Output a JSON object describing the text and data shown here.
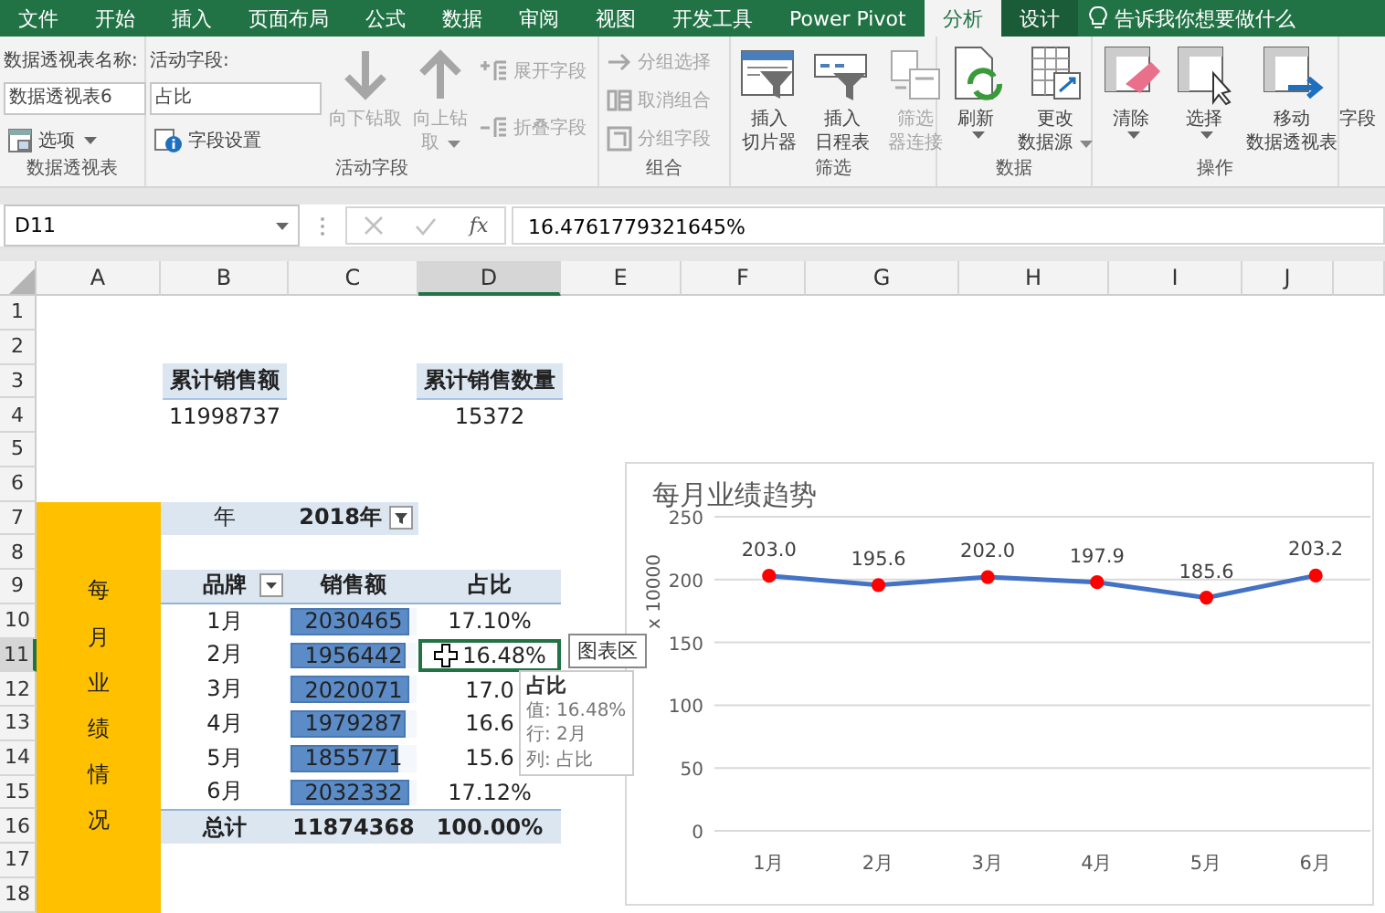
{
  "menu_tabs": [
    {
      "label": "文件",
      "selected": false,
      "contextual": false
    },
    {
      "label": "开始",
      "selected": false,
      "contextual": false
    },
    {
      "label": "插入",
      "selected": false,
      "contextual": false
    },
    {
      "label": "页面布局",
      "selected": false,
      "contextual": false
    },
    {
      "label": "公式",
      "selected": false,
      "contextual": false
    },
    {
      "label": "数据",
      "selected": false,
      "contextual": false
    },
    {
      "label": "审阅",
      "selected": false,
      "contextual": false
    },
    {
      "label": "视图",
      "selected": false,
      "contextual": false
    },
    {
      "label": "开发工具",
      "selected": false,
      "contextual": false
    },
    {
      "label": "Power Pivot",
      "selected": false,
      "contextual": false
    },
    {
      "label": "分析",
      "selected": true,
      "contextual": true
    },
    {
      "label": "设计",
      "selected": false,
      "contextual": true
    }
  ],
  "tell_me": "告诉我你想要做什么",
  "ribbon": [
    {
      "label": "数据透视表",
      "columns": [
        [
          {
            "kind": "caption",
            "label": "数据透视表名称:"
          },
          {
            "kind": "input",
            "value": "数据透视表6"
          },
          {
            "kind": "small",
            "label": "选项",
            "disabled": false,
            "dropdown": true
          }
        ]
      ]
    },
    {
      "label": "活动字段",
      "columns": [
        [
          {
            "kind": "caption",
            "label": "活动字段:"
          },
          {
            "kind": "input",
            "value": "占比"
          },
          {
            "kind": "small",
            "label": "字段设置",
            "disabled": false,
            "dropdown": false
          }
        ],
        [
          {
            "kind": "large",
            "lines": [
              "向下钻取"
            ],
            "disabled": true,
            "dropdown": false
          }
        ],
        [
          {
            "kind": "large",
            "lines": [
              "向上钻",
              "取"
            ],
            "disabled": true,
            "dropdown": true
          }
        ],
        [
          {
            "kind": "small",
            "label": "展开字段",
            "disabled": true,
            "dropdown": false
          },
          {
            "kind": "small",
            "label": "折叠字段",
            "disabled": true,
            "dropdown": false
          }
        ]
      ]
    },
    {
      "label": "组合",
      "columns": [
        [
          {
            "kind": "small",
            "label": "分组选择",
            "disabled": true,
            "dropdown": false
          },
          {
            "kind": "small",
            "label": "取消组合",
            "disabled": true,
            "dropdown": false
          },
          {
            "kind": "small",
            "label": "分组字段",
            "disabled": true,
            "dropdown": false
          }
        ]
      ]
    },
    {
      "label": "筛选",
      "columns": [
        [
          {
            "kind": "large",
            "lines": [
              "插入",
              "切片器"
            ],
            "disabled": false,
            "dropdown": false
          }
        ],
        [
          {
            "kind": "large",
            "lines": [
              "插入",
              "日程表"
            ],
            "disabled": false,
            "dropdown": false
          }
        ],
        [
          {
            "kind": "large",
            "lines": [
              "筛选",
              "器连接"
            ],
            "disabled": true,
            "dropdown": false
          }
        ]
      ]
    },
    {
      "label": "数据",
      "columns": [
        [
          {
            "kind": "large",
            "lines": [
              "刷新"
            ],
            "disabled": false,
            "dropdown": true
          }
        ],
        [
          {
            "kind": "large",
            "lines": [
              "更改",
              "数据源"
            ],
            "disabled": false,
            "dropdown": true
          }
        ]
      ]
    },
    {
      "label": "操作",
      "columns": [
        [
          {
            "kind": "large",
            "lines": [
              "清除"
            ],
            "disabled": false,
            "dropdown": true
          }
        ],
        [
          {
            "kind": "large",
            "lines": [
              "选择"
            ],
            "disabled": false,
            "dropdown": true
          }
        ],
        [
          {
            "kind": "large",
            "lines": [
              "移动",
              "数据透视表"
            ],
            "disabled": false,
            "dropdown": false
          }
        ]
      ]
    },
    {
      "columns": [
        [
          {
            "kind": "large",
            "lines": [
              "字段"
            ],
            "disabled": false,
            "dropdown": false
          }
        ]
      ]
    }
  ],
  "formula_bar": {
    "name_box": "D11",
    "fx": "fx",
    "formula": "16.4761779321645%"
  },
  "columns": [
    {
      "label": "A",
      "selected": false
    },
    {
      "label": "B",
      "selected": false
    },
    {
      "label": "C",
      "selected": false
    },
    {
      "label": "D",
      "selected": true
    },
    {
      "label": "E",
      "selected": false
    },
    {
      "label": "F",
      "selected": false
    },
    {
      "label": "G",
      "selected": false
    },
    {
      "label": "H",
      "selected": false
    },
    {
      "label": "I",
      "selected": false
    },
    {
      "label": "J",
      "selected": false
    }
  ],
  "rows": [
    {
      "label": "1",
      "selected": false
    },
    {
      "label": "2",
      "selected": false
    },
    {
      "label": "3",
      "selected": false
    },
    {
      "label": "4",
      "selected": false
    },
    {
      "label": "5",
      "selected": false
    },
    {
      "label": "6",
      "selected": false
    },
    {
      "label": "7",
      "selected": false
    },
    {
      "label": "8",
      "selected": false
    },
    {
      "label": "9",
      "selected": false
    },
    {
      "label": "10",
      "selected": false
    },
    {
      "label": "11",
      "selected": true
    },
    {
      "label": "12",
      "selected": false
    },
    {
      "label": "13",
      "selected": false
    },
    {
      "label": "14",
      "selected": false
    },
    {
      "label": "15",
      "selected": false
    },
    {
      "label": "16",
      "selected": false
    },
    {
      "label": "17",
      "selected": false
    },
    {
      "label": "18",
      "selected": false
    }
  ],
  "summary": [
    {
      "label": "累计销售额",
      "value": "11998737"
    },
    {
      "label": "累计销售数量",
      "value": "15372"
    }
  ],
  "side_label": "每月业绩情况",
  "pivot": {
    "filter": {
      "label": "年",
      "value": "2018年"
    },
    "headers": [
      "品牌",
      "销售额",
      "占比"
    ],
    "rows": [
      {
        "month": "1月",
        "sales": "2030465",
        "level": 0.999,
        "share": "17.10%",
        "selected": false
      },
      {
        "month": "2月",
        "sales": "1956442",
        "level": 0.963,
        "share": "16.48%",
        "selected": true
      },
      {
        "month": "3月",
        "sales": "2020071",
        "level": 0.994,
        "share": "17.0",
        "selected": false
      },
      {
        "month": "4月",
        "sales": "1979287",
        "level": 0.974,
        "share": "16.6",
        "selected": false
      },
      {
        "month": "5月",
        "sales": "1855771",
        "level": 0.913,
        "share": "15.6",
        "selected": false
      },
      {
        "month": "6月",
        "sales": "2032332",
        "level": 1.0,
        "share": "17.12%",
        "selected": false
      }
    ],
    "total": {
      "label": "总计",
      "sales": "11874368",
      "share": "100.00%"
    }
  },
  "cell_tooltip": {
    "title": "占比",
    "lines": [
      "值: 16.48%",
      "行: 2月",
      "列: 占比"
    ]
  },
  "chart_tooltip": "图表区",
  "chart": {
    "chart_data": {
      "type": "line",
      "title": "每月业绩趋势",
      "ylabel": "x 10000",
      "categories": [
        "1月",
        "2月",
        "3月",
        "4月",
        "5月",
        "6月"
      ],
      "series": [
        {
          "color": "#4472c4",
          "marker": "circle",
          "values": [
            203.0,
            195.6,
            202.0,
            197.9,
            185.6,
            203.2
          ]
        }
      ],
      "ylim": [
        0,
        250
      ],
      "yticks": [
        0,
        50,
        100,
        150,
        200,
        250
      ],
      "grid": true,
      "value_labels": [
        "203.0",
        "195.6",
        "202.0",
        "197.9",
        "185.6",
        "203.2"
      ]
    }
  }
}
